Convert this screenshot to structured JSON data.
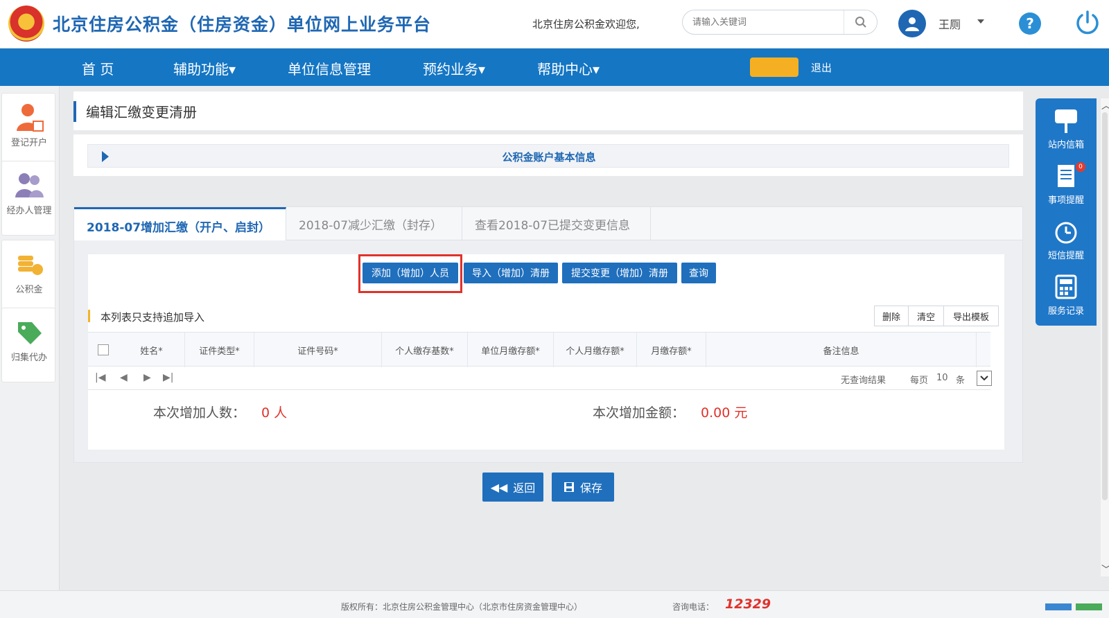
{
  "header": {
    "title": "北京住房公积金（住房资金）单位网上业务平台",
    "welcome": "北京住房公积金欢迎您,",
    "search_placeholder": "请输入关键词",
    "user_name": "王厕"
  },
  "nav": {
    "items": [
      {
        "label": "首  页"
      },
      {
        "label": "辅助功能▾"
      },
      {
        "label": "单位信息管理"
      },
      {
        "label": "预约业务▾"
      },
      {
        "label": "帮助中心▾"
      }
    ],
    "extra_label": "退出"
  },
  "left_sidebar": {
    "items": [
      {
        "label": "登记开户"
      },
      {
        "label": "经办人管理"
      },
      {
        "label": "公积金"
      },
      {
        "label": "归集代办"
      }
    ]
  },
  "right_sidebar": {
    "items": [
      {
        "label": "站内信箱"
      },
      {
        "label": "事项提醒",
        "badge": "0"
      },
      {
        "label": "短信提醒"
      },
      {
        "label": "服务记录"
      }
    ]
  },
  "page": {
    "title": "编辑汇缴变更清册",
    "info_panel_title": "公积金账户基本信息"
  },
  "tabs": [
    {
      "label": "2018-07增加汇缴（开户、启封）",
      "active": true
    },
    {
      "label": "2018-07减少汇缴（封存）",
      "active": false
    },
    {
      "label": "查看2018-07已提交变更信息",
      "active": false
    }
  ],
  "toolbar": {
    "add_person": "添加（增加）人员",
    "import_list": "导入（增加）清册",
    "submit_change": "提交变更（增加）清册",
    "query": "查询"
  },
  "list": {
    "note": "本列表只支持追加导入",
    "delete": "删除",
    "clear": "清空",
    "export_template": "导出模板",
    "columns": [
      "姓名*",
      "证件类型*",
      "证件号码*",
      "个人缴存基数*",
      "单位月缴存额*",
      "个人月缴存额*",
      "月缴存额*",
      "备注信息"
    ],
    "pager": {
      "no_results": "无查询结果",
      "per_page_prefix": "每页",
      "per_page": "10",
      "per_page_suffix": "条"
    }
  },
  "summary": {
    "count_label": "本次增加人数：",
    "count_value": "0 人",
    "amount_label": "本次增加金额：",
    "amount_value": "0.00 元"
  },
  "actions": {
    "back": "返回",
    "save": "保存"
  },
  "footer": {
    "copyright": "版权所有：北京住房公积金管理中心（北京市住房资金管理中心）",
    "phone_label": "咨询电话：",
    "phone": "12329"
  },
  "colors": {
    "primary": "#1576c4",
    "highlight": "#e0322b",
    "accent": "#f4b022"
  }
}
